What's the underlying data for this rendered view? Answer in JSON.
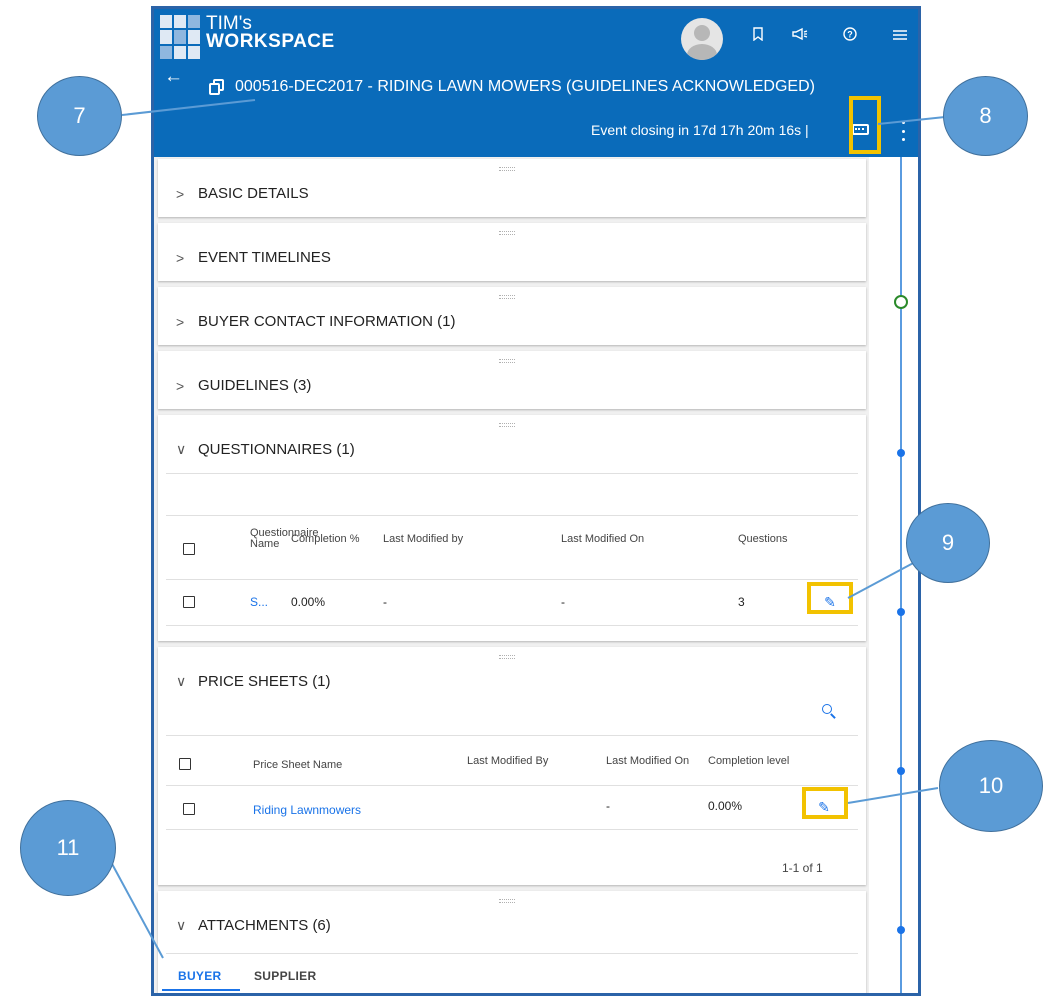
{
  "header": {
    "brand_line1": "TIM's",
    "brand_line2": "WORKSPACE",
    "event_title": "000516-DEC2017 - RIDING LAWN MOWERS (GUIDELINES ACKNOWLEDGED)",
    "closing_text": "Event closing in  17d 17h 20m 16s  |"
  },
  "sections": {
    "basic_details": "BASIC DETAILS",
    "event_timelines": "EVENT TIMELINES",
    "buyer_contact": "BUYER CONTACT INFORMATION (1)",
    "guidelines": "GUIDELINES (3)",
    "questionnaires": "QUESTIONNAIRES (1)",
    "price_sheets": "PRICE SHEETS (1)",
    "attachments": "ATTACHMENTS (6)"
  },
  "questionnaires_table": {
    "headers": [
      "Questionnaire Name",
      "Completion %",
      "Last Modified by",
      "Last Modified On",
      "Questions"
    ],
    "rows": [
      {
        "name": "S...",
        "completion": "0.00%",
        "modified_by": "-",
        "modified_on": "-",
        "questions": "3"
      }
    ]
  },
  "price_sheets_table": {
    "headers": [
      "Price Sheet Name",
      "Last Modified By",
      "Last Modified On",
      "Completion level"
    ],
    "rows": [
      {
        "name": "Riding Lawnmowers",
        "modified_by": "",
        "modified_on": "-",
        "completion": "0.00%"
      }
    ],
    "pagination": "1-1 of 1"
  },
  "attachment_tabs": [
    "BUYER",
    "SUPPLIER"
  ],
  "callouts": [
    "7",
    "8",
    "9",
    "10",
    "11"
  ],
  "colors": {
    "header_bg": "#0a6bba",
    "link": "#1a73e8",
    "highlight": "#f2c200",
    "callout": "#5b9bd5"
  },
  "icons": [
    "logo-grid-icon",
    "avatar-icon",
    "bookmark-icon",
    "megaphone-icon",
    "help-icon",
    "menu-icon",
    "back-arrow-icon",
    "copy-icon",
    "chat-icon",
    "more-vertical-icon",
    "chevron-right-icon",
    "chevron-down-icon",
    "edit-pencil-icon",
    "search-icon"
  ]
}
